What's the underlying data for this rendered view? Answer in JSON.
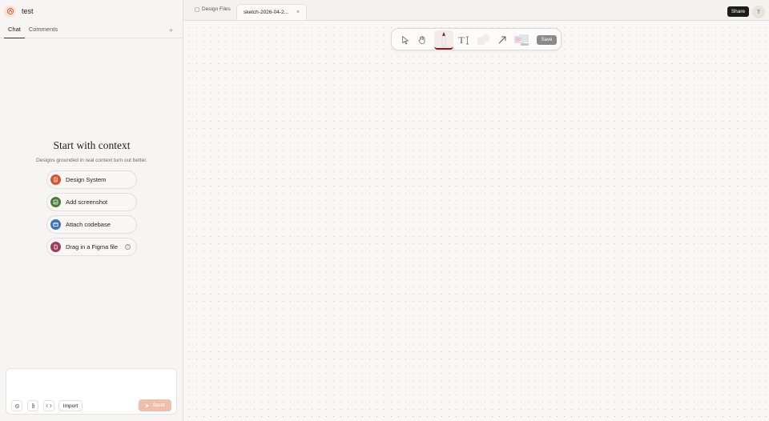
{
  "project": {
    "name": "test"
  },
  "left_tabs": [
    {
      "label": "Chat"
    },
    {
      "label": "Comments"
    }
  ],
  "plus_label": "+",
  "context": {
    "title": "Start with context",
    "subtitle": "Designs grounded in real context turn out better.",
    "options": [
      {
        "label": "Design System",
        "icon": "design-system-icon",
        "color": "#d4532f"
      },
      {
        "label": "Add screenshot",
        "icon": "screenshot-icon",
        "color": "#4d7a3c"
      },
      {
        "label": "Attach codebase",
        "icon": "codebase-icon",
        "color": "#3d73b8"
      },
      {
        "label": "Drag in a Figma file",
        "icon": "figma-file-icon",
        "color": "#9a3c5a"
      }
    ],
    "help_glyph": "?"
  },
  "composer": {
    "import_label": "Import",
    "send_label": "Send"
  },
  "file_tabs": [
    {
      "label": "Design Files",
      "icon": "folder-icon"
    },
    {
      "label": "sketch-2026-04-2...",
      "close": "×"
    }
  ],
  "header": {
    "share_label": "Share",
    "avatar_initial": "T"
  },
  "toolbar": {
    "tools": [
      "select-arrow-icon",
      "hand-pan-icon",
      "pen-icon",
      "text-icon",
      "shape-color-icon",
      "arrow-icon",
      "sticky-note-icon"
    ],
    "text_tool_label": "T",
    "save_label": "Save"
  },
  "colors": {
    "accent": "#f1bfa9",
    "brand": "#d4532f",
    "share_bg": "#1c1c1c",
    "pen_accent": "#8b1a1a"
  }
}
